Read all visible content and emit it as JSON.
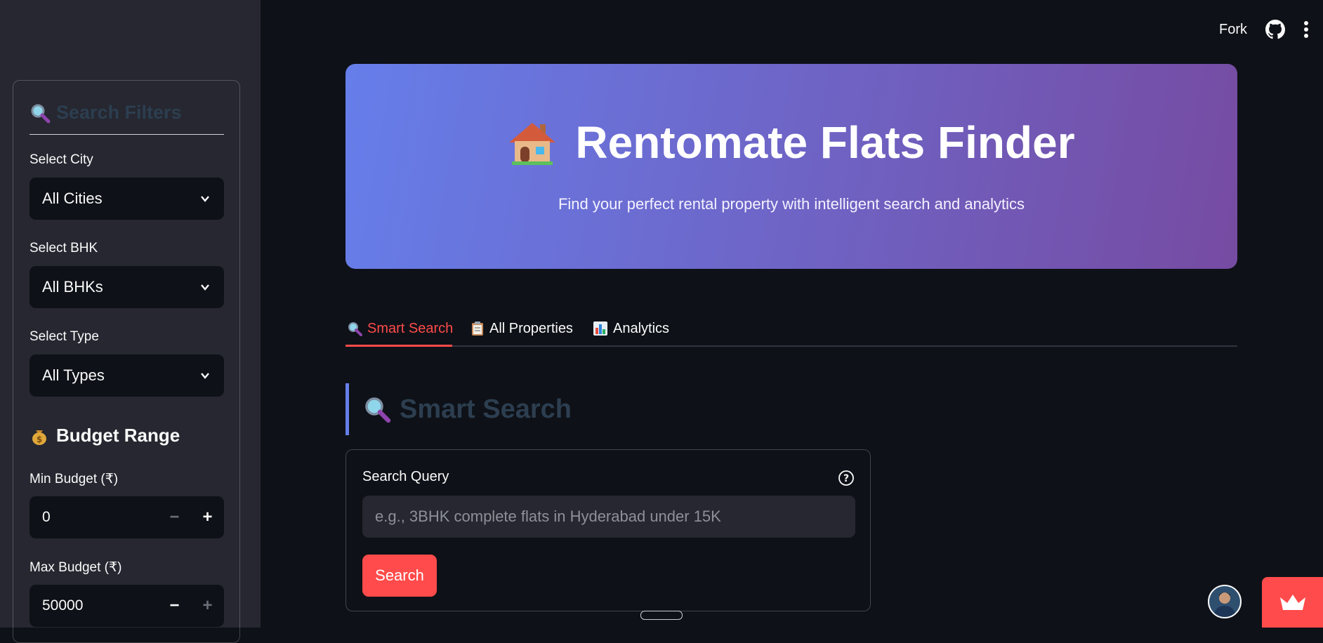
{
  "toolbar": {
    "fork_label": "Fork",
    "github_icon": "github-icon",
    "menu_icon": "kebab-menu-icon"
  },
  "sidebar": {
    "filters_title": "Search Filters",
    "city": {
      "label": "Select City",
      "value": "All Cities"
    },
    "bhk": {
      "label": "Select BHK",
      "value": "All BHKs"
    },
    "type": {
      "label": "Select Type",
      "value": "All Types"
    },
    "budget_heading": "Budget Range",
    "min_budget": {
      "label": "Min Budget (₹)",
      "value": "0"
    },
    "max_budget": {
      "label": "Max Budget (₹)",
      "value": "50000"
    }
  },
  "hero": {
    "title": "Rentomate Flats Finder",
    "subtitle": "Find your perfect rental property with intelligent search and analytics"
  },
  "tabs": [
    {
      "label": "Smart Search",
      "icon": "magnifier-icon",
      "active": true
    },
    {
      "label": "All Properties",
      "icon": "clipboard-icon",
      "active": false
    },
    {
      "label": "Analytics",
      "icon": "bar-chart-icon",
      "active": false
    }
  ],
  "main": {
    "section_title": "Smart Search",
    "search": {
      "label": "Search Query",
      "placeholder": "e.g., 3BHK complete flats in Hyderabad under 15K",
      "button_label": "Search"
    }
  },
  "colors": {
    "accent": "#ff4b4b",
    "gradient_start": "#667eea",
    "gradient_end": "#764ba2",
    "background": "#0e1117",
    "sidebar": "#262730"
  }
}
